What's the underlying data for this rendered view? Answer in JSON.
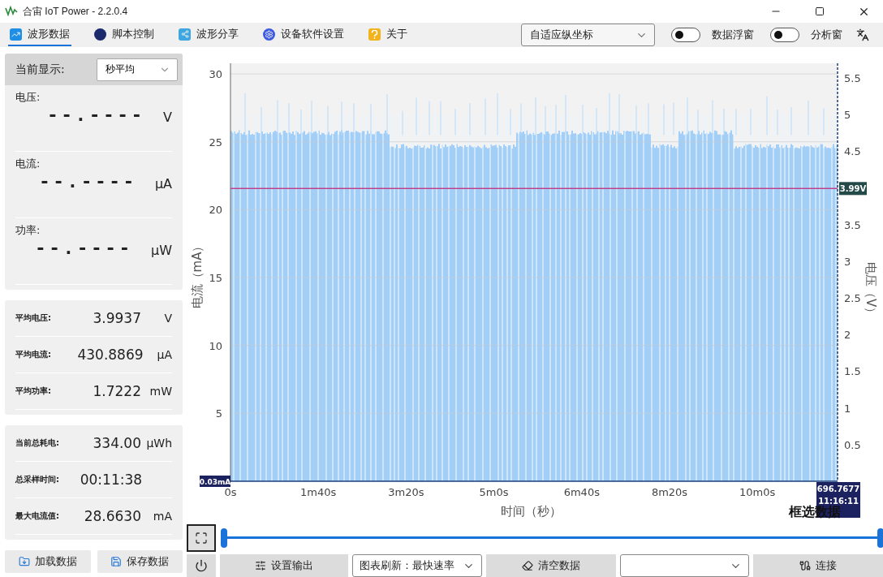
{
  "window": {
    "title": "合宙 IoT Power - 2.2.0.4"
  },
  "tabs": [
    {
      "label": "波形数据",
      "kind": "wave",
      "selected": true
    },
    {
      "label": "脚本控制",
      "kind": "script",
      "selected": false
    },
    {
      "label": "波形分享",
      "kind": "share",
      "selected": false
    },
    {
      "label": "设备软件设置",
      "kind": "settings",
      "selected": false
    },
    {
      "label": "关于",
      "kind": "about",
      "selected": false
    }
  ],
  "axis_mode": {
    "value": "自适应纵坐标"
  },
  "toggles": [
    {
      "label": "数据浮窗",
      "on": false
    },
    {
      "label": "分析窗",
      "on": false
    }
  ],
  "live_panel": {
    "label": "当前显示:",
    "mode": "秒平均",
    "readings": [
      {
        "label": "电压:",
        "value": "--.----",
        "unit": "V"
      },
      {
        "label": "电流:",
        "value": "--.----",
        "unit": "μA"
      },
      {
        "label": "功率:",
        "value": "--.----",
        "unit": "μW"
      }
    ]
  },
  "averages": [
    {
      "label": "平均电压:",
      "value": "3.9937",
      "unit": "V"
    },
    {
      "label": "平均电流:",
      "value": "430.8869",
      "unit": "μA"
    },
    {
      "label": "平均功率:",
      "value": "1.7222",
      "unit": "mW"
    }
  ],
  "totals": [
    {
      "label": "当前总耗电:",
      "value": "334.00",
      "unit": "μWh"
    },
    {
      "label": "总采样时间:",
      "value": "00:11:38"
    },
    {
      "label": "最大电流值:",
      "value": "28.6630",
      "unit": "mA"
    }
  ],
  "time_slider": {
    "level": 1
  },
  "file_buttons": [
    "加载数据",
    "保存数据"
  ],
  "chart": {
    "left_title": "电流（mA）",
    "right_title": "电压（V）",
    "x_title": "时间（秒）",
    "left_ticks": [
      "30",
      "25",
      "20",
      "15",
      "10",
      "5"
    ],
    "right_ticks": [
      "5.5",
      "5",
      "4.5",
      "3.5",
      "3",
      "2.5",
      "2",
      "1.5",
      "1",
      "0.5"
    ],
    "x_ticks": [
      "0s",
      "1m40s",
      "3m20s",
      "5m0s",
      "6m40s",
      "8m20s",
      "10m0s"
    ],
    "min_label": "0.03mA",
    "voltage_label": "3.99V",
    "cursor_lines": [
      "696.7677",
      "11:16:11"
    ],
    "select_label": "框选数据"
  },
  "bottom_bar": {
    "output_button": "设置输出",
    "refresh_select": "图表刷新：最快速率",
    "clear_button": "清空数据",
    "connect_button": "连接"
  }
}
